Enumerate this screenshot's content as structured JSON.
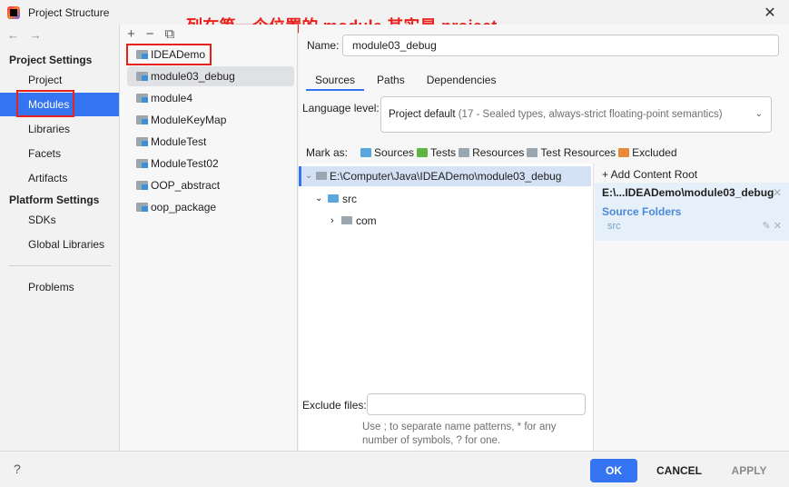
{
  "window": {
    "title": "Project Structure",
    "close": "✕"
  },
  "annotation": "列在第一个位置的 module 其实是 project",
  "nav": {
    "back": "←",
    "forward": "→"
  },
  "sidebar": {
    "project_settings": "Project Settings",
    "items_project": [
      "Project",
      "Modules",
      "Libraries",
      "Facets",
      "Artifacts"
    ],
    "platform_settings": "Platform Settings",
    "items_platform": [
      "SDKs",
      "Global Libraries"
    ],
    "problems": "Problems",
    "selected": "Modules"
  },
  "modules": {
    "toolbar": {
      "add": "+",
      "remove": "−",
      "copy": "⧉"
    },
    "items": [
      "IDEADemo",
      "module03_debug",
      "module4",
      "ModuleKeyMap",
      "ModuleTest",
      "ModuleTest02",
      "OOP_abstract",
      "oop_package"
    ],
    "selected": "module03_debug"
  },
  "detail": {
    "name_label": "Name:",
    "name_value": "module03_debug",
    "tabs": [
      "Sources",
      "Paths",
      "Dependencies"
    ],
    "active_tab": "Sources",
    "language_label": "Language level:",
    "language_value": "Project default",
    "language_desc": "(17 - Sealed types, always-strict floating-point semantics)",
    "mark_as_label": "Mark as:",
    "mark_as": [
      {
        "label": "Sources",
        "color": "#5aa7e0"
      },
      {
        "label": "Tests",
        "color": "#62b543"
      },
      {
        "label": "Resources",
        "color": "#9aa7b0"
      },
      {
        "label": "Test Resources",
        "color": "#9aa7b0"
      },
      {
        "label": "Excluded",
        "color": "#e8883a"
      }
    ],
    "tree": {
      "root": "E:\\Computer\\Java\\IDEADemo\\module03_debug",
      "src": "src",
      "com": "com"
    },
    "exclude_label": "Exclude files:",
    "exclude_value": "",
    "exclude_hint": "Use ; to separate name patterns, * for any number of symbols, ? for one."
  },
  "content_roots": {
    "add_label": "+ Add Content Root",
    "root_path": "E:\\...IDEADemo\\module03_debug",
    "source_folders_title": "Source Folders",
    "source_folder": "src",
    "remove": "✕",
    "edit": "✎"
  },
  "buttons": {
    "help": "?",
    "ok": "OK",
    "cancel": "CANCEL",
    "apply": "APPLY"
  },
  "colors": {
    "accent": "#3574f0",
    "annotation": "#e8211d"
  }
}
